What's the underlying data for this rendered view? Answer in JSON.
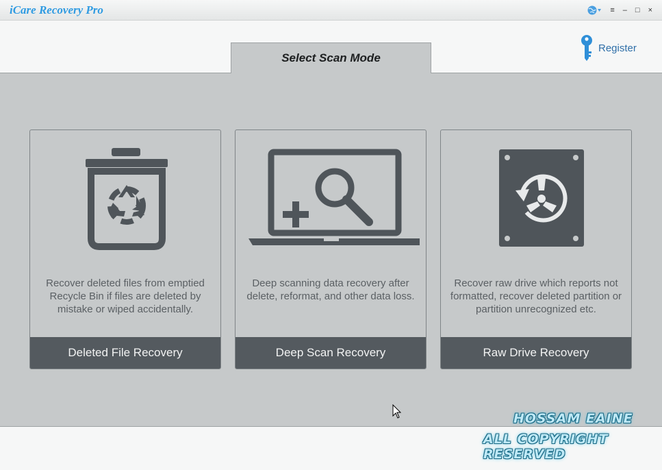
{
  "app": {
    "title": "iCare Recovery Pro"
  },
  "window_controls": {
    "globe_icon": "globe-icon",
    "menu": "≡",
    "minimize": "–",
    "maximize": "□",
    "close": "×"
  },
  "header": {
    "tab_label": "Select Scan Mode",
    "register_label": "Register"
  },
  "cards": [
    {
      "icon": "recycle-bin-icon",
      "description": "Recover deleted files from emptied Recycle Bin if files are deleted by mistake or wiped accidentally.",
      "button": "Deleted File Recovery"
    },
    {
      "icon": "deep-scan-laptop-icon",
      "description": "Deep scanning data recovery after delete, reformat, and other data loss.",
      "button": "Deep Scan Recovery"
    },
    {
      "icon": "raw-drive-icon",
      "description": "Recover raw drive which reports not formatted, recover deleted partition or partition unrecognized etc.",
      "button": "Raw Drive Recovery"
    }
  ],
  "watermark": {
    "line1": "HOSSAM EAINE",
    "line2": "ALL COPYRIGHT RESERVED"
  },
  "colors": {
    "accent": "#2f9be2",
    "panel": "#c6c9ca",
    "button": "#545a5f",
    "icon": "#4f555a"
  }
}
